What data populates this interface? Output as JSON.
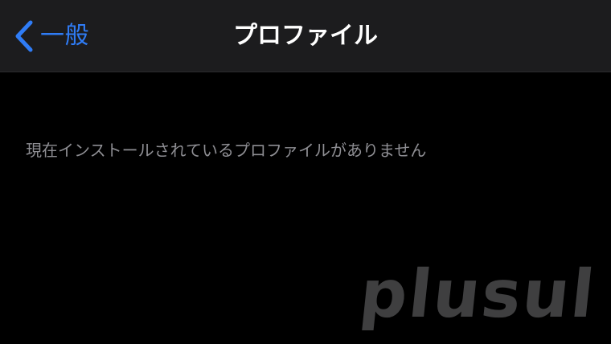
{
  "nav": {
    "back_label": "一般",
    "title": "プロファイル"
  },
  "content": {
    "empty_message": "現在インストールされているプロファイルがありません"
  },
  "watermark": {
    "text": "plusul"
  },
  "colors": {
    "background": "#000000",
    "nav_background": "#1c1c1e",
    "accent": "#2f7cf6",
    "title_text": "#ffffff",
    "secondary_text": "#8e8e93",
    "watermark": "#4a4a4c"
  },
  "icons": {
    "back": "chevron-left-icon"
  }
}
